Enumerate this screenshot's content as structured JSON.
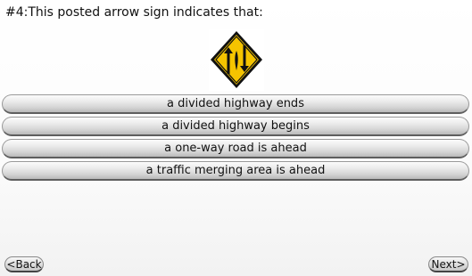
{
  "question": {
    "text": "#4:This posted arrow sign indicates that:"
  },
  "sign": {
    "icon": "divided-highway-ends-sign-icon",
    "color_fill": "#f5c400",
    "color_border": "#111111"
  },
  "answers": [
    {
      "label": "a divided highway ends"
    },
    {
      "label": "a divided highway begins"
    },
    {
      "label": "a one-way road is ahead"
    },
    {
      "label": "a traffic merging area is ahead"
    }
  ],
  "nav": {
    "back_label": "<Back",
    "next_label": "Next>"
  }
}
